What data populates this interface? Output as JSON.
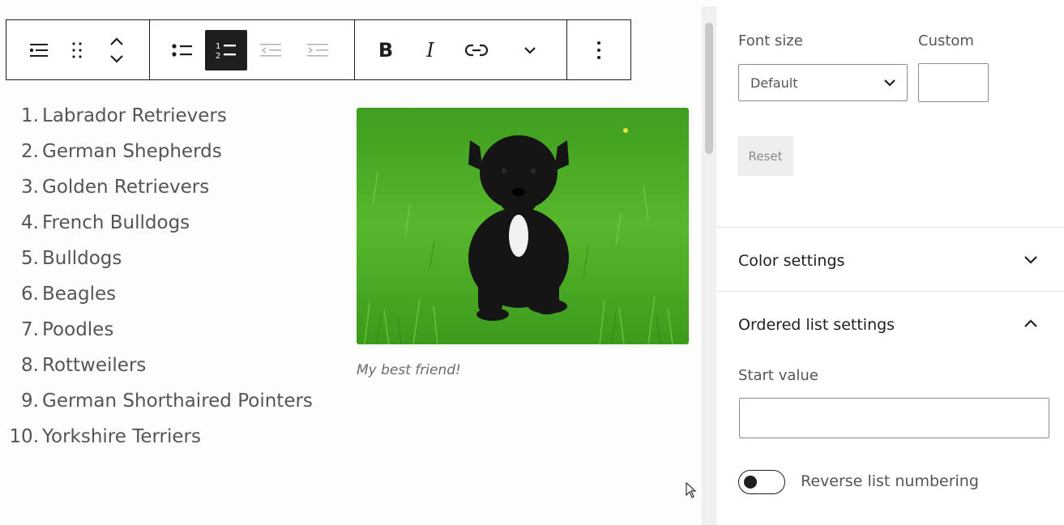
{
  "toolbar": {
    "groups": [
      [
        "list-block-icon",
        "drag-handle-icon",
        "move-up-down-icon"
      ],
      [
        "unordered-list-icon",
        "ordered-list-icon",
        "outdent-icon",
        "indent-icon"
      ],
      [
        "bold",
        "italic",
        "link-icon",
        "more-rich-text-icon"
      ],
      [
        "options-icon"
      ]
    ],
    "bold_label": "B",
    "italic_label": "I"
  },
  "list": {
    "items": [
      {
        "num": "1.",
        "text": "Labrador Retrievers"
      },
      {
        "num": "2.",
        "text": "German Shepherds"
      },
      {
        "num": "3.",
        "text": "Golden Retrievers"
      },
      {
        "num": "4.",
        "text": "French Bulldogs"
      },
      {
        "num": "5.",
        "text": "Bulldogs"
      },
      {
        "num": "6.",
        "text": "Beagles"
      },
      {
        "num": "7.",
        "text": "Poodles"
      },
      {
        "num": "8.",
        "text": "Rottweilers"
      },
      {
        "num": "9.",
        "text": "German Shorthaired Pointers"
      },
      {
        "num": "10.",
        "text": "Yorkshire Terriers"
      }
    ]
  },
  "image": {
    "caption": "My best friend!"
  },
  "sidebar": {
    "font_size_label": "Font size",
    "custom_label": "Custom",
    "font_size_value": "Default",
    "custom_value": "",
    "reset_label": "Reset",
    "color_settings_title": "Color settings",
    "ordered_list_title": "Ordered list settings",
    "start_value_label": "Start value",
    "start_value": "",
    "reverse_label": "Reverse list numbering",
    "reverse_on": false
  },
  "colors": {
    "text": "#1e1e1e",
    "muted": "#555555",
    "active_button": "#1e1e1e",
    "grass": "#4caf2a"
  }
}
